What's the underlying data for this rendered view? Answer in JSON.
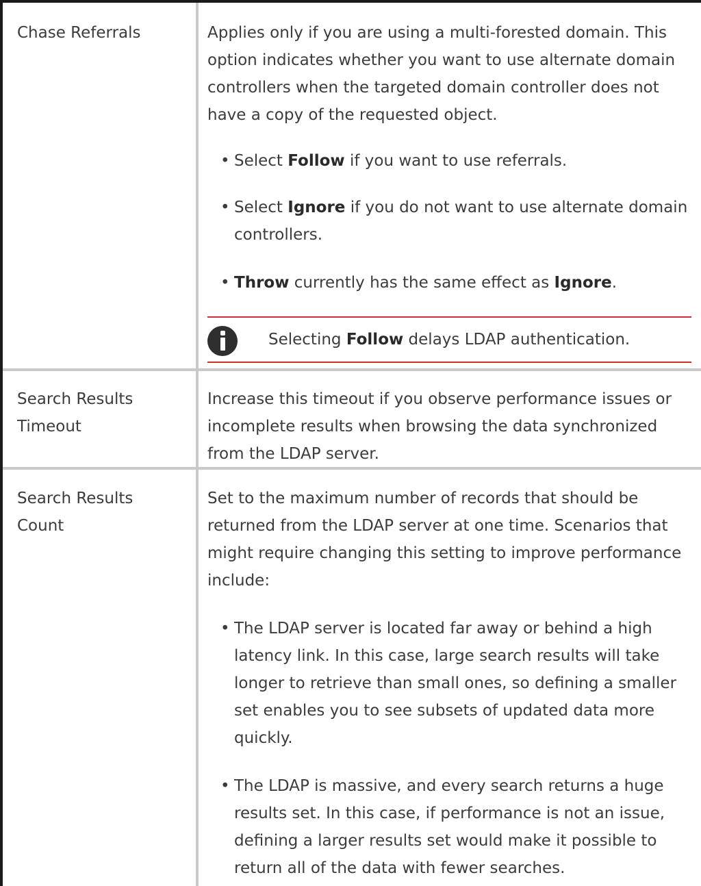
{
  "rows": [
    {
      "label": "Chase Referrals",
      "description": "Applies only if you are using a multi-forested domain. This option indicates whether you want to use alternate domain controllers when the targeted domain controller does not have a copy of the requested object.",
      "bullets": [
        {
          "pre": "Select ",
          "bold": "Follow",
          "post": " if you want to use referrals."
        },
        {
          "pre": "Select ",
          "bold": "Ignore",
          "post": " if you do not want to use alternate domain controllers."
        },
        {
          "pre": "",
          "bold": "Throw",
          "post": " currently has the same effect as ",
          "bold2": "Ignore",
          "post2": "."
        }
      ],
      "note": {
        "pre": "Selecting ",
        "bold": "Follow",
        "post": " delays LDAP authentication.",
        "icon": "info-icon"
      }
    },
    {
      "label": "Search Results Timeout",
      "description": "Increase this timeout if you observe performance issues or incomplete results when browsing the data synchronized from the LDAP server."
    },
    {
      "label": "Search Results Count",
      "description": "Set to the maximum number of records that should be returned from the LDAP server at one time. Scenarios that might require changing this setting to improve performance include:",
      "bullets": [
        {
          "text": "The LDAP server is located far away or behind a high latency link. In this case, large search results will take longer to retrieve than small ones, so defining a smaller set enables you to see subsets of updated data more quickly."
        },
        {
          "text": "The LDAP is massive, and every search returns a huge results set. In this case, if performance is not an issue, defining a larger results set would make it possible to return all of the data with fewer searches."
        }
      ]
    }
  ],
  "colors": {
    "border_dark": "#1a1a1a",
    "grid": "#c9c9c9",
    "note_rule": "#d12b2b",
    "text": "#3c3c3c"
  }
}
